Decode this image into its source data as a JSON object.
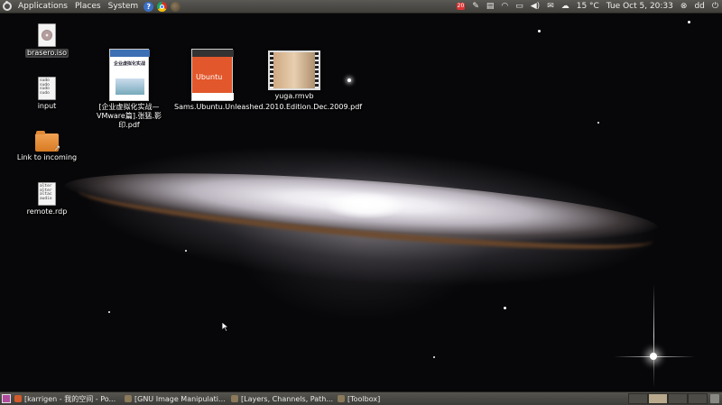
{
  "top_panel": {
    "menus": [
      "Applications",
      "Places",
      "System"
    ],
    "launchers": [
      "help-icon",
      "chrome-icon",
      "gimp-icon"
    ],
    "help_glyph": "?",
    "mail_badge": "20",
    "weather": "15 °C",
    "clock": "Tue Oct  5, 20:33",
    "user": "dd"
  },
  "desktop": {
    "icons": [
      {
        "name": "brasero-iso",
        "label": "brasero.iso"
      },
      {
        "name": "input",
        "label": "input",
        "lines": [
          "sudo",
          "sudo",
          "sudo",
          "sudo"
        ]
      },
      {
        "name": "link-to-incoming",
        "label": "Link to incoming"
      },
      {
        "name": "remote-rdp",
        "label": "remote.rdp",
        "lines": [
          "alter",
          "alter",
          "altac",
          "audio"
        ]
      },
      {
        "name": "vmware-pdf",
        "label": "[企业虚拟化实战—VMware篇].张猛.影印.pdf",
        "cover_title": "企业虚拟化实战"
      },
      {
        "name": "ubuntu-pdf",
        "label": "Sams.Ubuntu.Unleashed.2010.Edition.Dec.2009.pdf",
        "cover_title": "Ubuntu"
      },
      {
        "name": "yuga-rmvb",
        "label": "yuga.rmvb"
      }
    ]
  },
  "taskbar": {
    "tasks": [
      {
        "label": "[karrigen - 我的空间 - Po...",
        "icon_color": "#d35a2a"
      },
      {
        "label": "[GNU Image Manipulati...",
        "icon_color": "#8a7a5a"
      },
      {
        "label": "[Layers, Channels, Path...",
        "icon_color": "#8a7a5a"
      },
      {
        "label": "[Toolbox]",
        "icon_color": "#8a7a5a"
      }
    ],
    "workspaces": 4,
    "active_workspace": 1
  },
  "colors": {
    "panel": "#4a4944",
    "folder": "#e8913b",
    "mail_badge": "#dd3333"
  }
}
